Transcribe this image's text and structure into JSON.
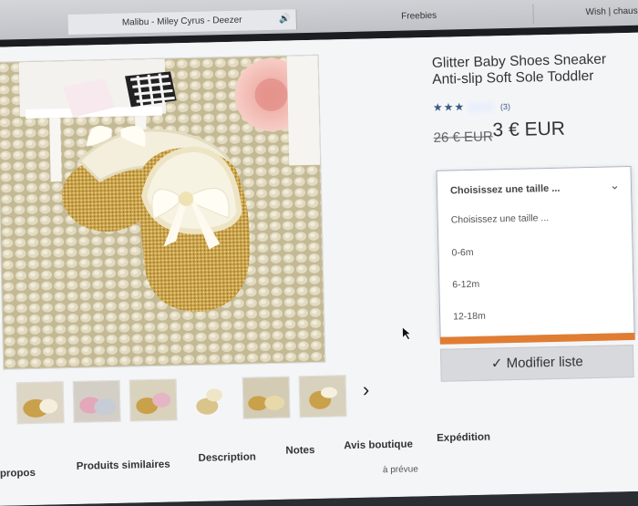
{
  "browser": {
    "tabs": [
      {
        "label": "Malibu - Miley Cyrus - Deezer",
        "icon": "speaker-icon"
      },
      {
        "label": "Freebies"
      },
      {
        "label": "Wish | chaus"
      }
    ]
  },
  "product": {
    "title": "Glitter Baby Shoes Sneaker Anti-slip Soft Sole Toddler",
    "rating_stars": "★★★",
    "rating_count": "(3)",
    "old_price": "26 € EUR",
    "price": "3 € EUR"
  },
  "size_select": {
    "selected": "Choisissez une taille ...",
    "options": [
      "Choisissez une taille ...",
      "0-6m",
      "6-12m",
      "12-18m"
    ]
  },
  "wish_button": {
    "label": "✓ Modifier liste"
  },
  "product_tabs": [
    "propos",
    "Produits similaires",
    "Description",
    "Notes",
    "Avis boutique",
    "Expédition"
  ],
  "partial_text": "à prévue",
  "colors": {
    "accent_orange": "#e07d33",
    "link_blue": "#3a5a86"
  }
}
